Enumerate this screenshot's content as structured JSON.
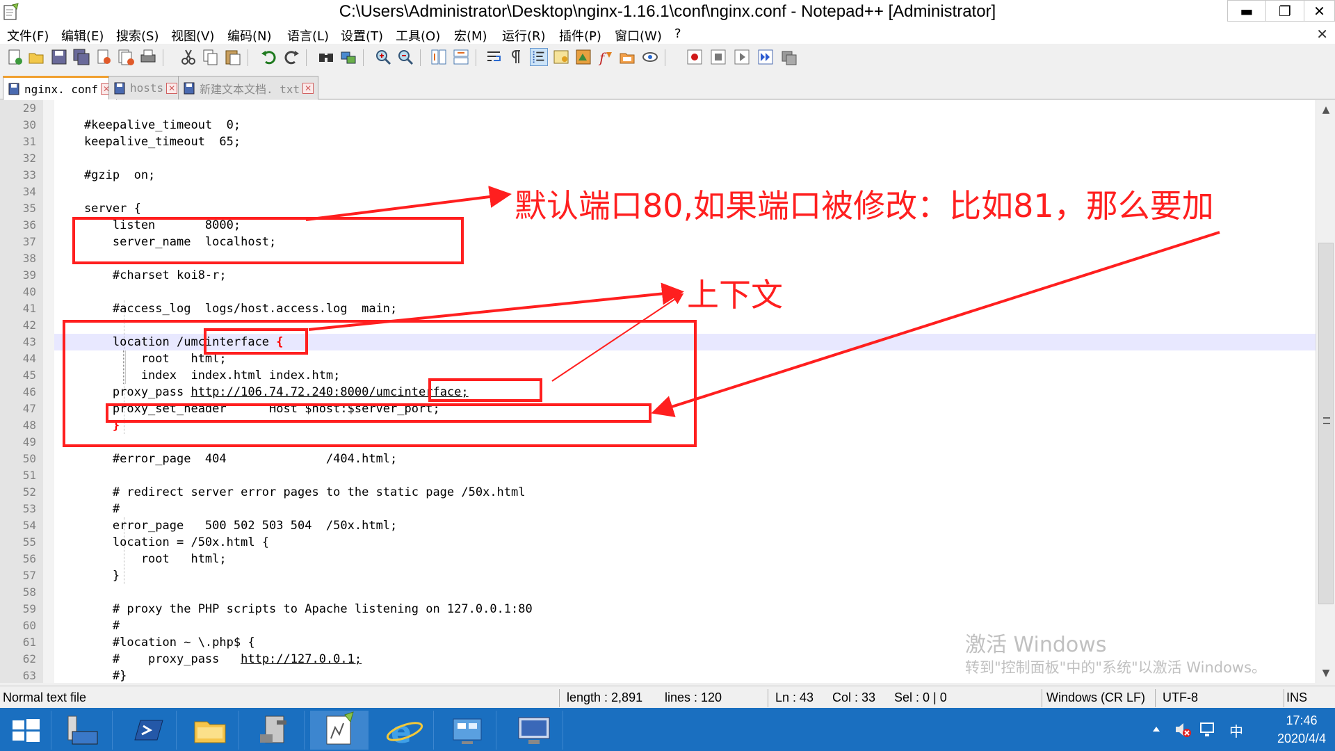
{
  "window": {
    "title": "C:\\Users\\Administrator\\Desktop\\nginx-1.16.1\\conf\\nginx.conf - Notepad++ [Administrator]",
    "min_glyph": "▬",
    "max_glyph": "❐",
    "close_glyph": "✕"
  },
  "menu": {
    "items": [
      "文件(F)",
      "编辑(E)",
      "搜索(S)",
      "视图(V)",
      "编码(N)",
      "语言(L)",
      "设置(T)",
      "工具(O)",
      "宏(M)",
      "运行(R)",
      "插件(P)",
      "窗口(W)",
      "?"
    ],
    "close_glyph": "✕"
  },
  "toolbar": {
    "icons": [
      "new-file-icon",
      "open-file-icon",
      "save-icon",
      "save-all-icon",
      "close-icon",
      "close-all-icon",
      "print-icon",
      "cut-icon",
      "copy-icon",
      "paste-icon",
      "undo-icon",
      "redo-icon",
      "find-icon",
      "replace-icon",
      "zoom-in-icon",
      "zoom-out-icon",
      "sync-vertical-icon",
      "sync-horizontal-icon",
      "word-wrap-icon",
      "show-all-chars-icon",
      "indent-guide-icon",
      "udl-icon",
      "doc-map-icon",
      "function-list-icon",
      "folder-workspace-icon",
      "monitoring-icon",
      "record-macro-icon",
      "stop-macro-icon",
      "play-macro-icon",
      "run-macro-multiple-icon",
      "save-macro-icon"
    ]
  },
  "tabs": [
    {
      "label": "nginx. conf",
      "close": "✕",
      "active": true
    },
    {
      "label": "hosts",
      "close": "✕",
      "active": false
    },
    {
      "label": "新建文本文档. txt",
      "close": "✕",
      "active": false
    }
  ],
  "editor": {
    "lines": [
      {
        "n": "29",
        "text": ""
      },
      {
        "n": "30",
        "text": "    #keepalive_timeout  0;"
      },
      {
        "n": "31",
        "text": "    keepalive_timeout  65;"
      },
      {
        "n": "32",
        "text": ""
      },
      {
        "n": "33",
        "text": "    #gzip  on;"
      },
      {
        "n": "34",
        "text": ""
      },
      {
        "n": "35",
        "text": "    server {"
      },
      {
        "n": "36",
        "text": "        listen       8000;"
      },
      {
        "n": "37",
        "text": "        server_name  localhost;"
      },
      {
        "n": "38",
        "text": ""
      },
      {
        "n": "39",
        "text": "        #charset koi8-r;"
      },
      {
        "n": "40",
        "text": ""
      },
      {
        "n": "41",
        "text": "        #access_log  logs/host.access.log  main;"
      },
      {
        "n": "42",
        "text": ""
      },
      {
        "n": "43",
        "text": "        location /umcinterface ",
        "tail": "{"
      },
      {
        "n": "44",
        "text": "            root   html;"
      },
      {
        "n": "45",
        "text": "            index  index.html index.htm;"
      },
      {
        "n": "46",
        "text": "        proxy_pass ",
        "url": "http://106.74.72.240:8000/umcinterface;"
      },
      {
        "n": "47",
        "text": "        proxy_set_header      Host $host:$server_port;"
      },
      {
        "n": "48",
        "text": "        ",
        "tail": "}"
      },
      {
        "n": "49",
        "text": ""
      },
      {
        "n": "50",
        "text": "        #error_page  404              /404.html;"
      },
      {
        "n": "51",
        "text": ""
      },
      {
        "n": "52",
        "text": "        # redirect server error pages to the static page /50x.html"
      },
      {
        "n": "53",
        "text": "        #"
      },
      {
        "n": "54",
        "text": "        error_page   500 502 503 504  /50x.html;"
      },
      {
        "n": "55",
        "text": "        location = /50x.html {"
      },
      {
        "n": "56",
        "text": "            root   html;"
      },
      {
        "n": "57",
        "text": "        }"
      },
      {
        "n": "58",
        "text": ""
      },
      {
        "n": "59",
        "text": "        # proxy the PHP scripts to Apache listening on 127.0.0.1:80"
      },
      {
        "n": "60",
        "text": "        #"
      },
      {
        "n": "61",
        "text": "        #location ~ \\.php$ {"
      },
      {
        "n": "62",
        "text": "        #    proxy_pass   ",
        "url": "http://127.0.0.1;"
      },
      {
        "n": "63",
        "text": "        #}"
      }
    ]
  },
  "scrollbar": {
    "up": "▲",
    "down": "▼"
  },
  "annotations": {
    "note_port": "默认端口80,如果端口被修改：比如81，那么要加",
    "note_context": "上下文"
  },
  "watermark": {
    "line1": "激活 Windows",
    "line2": "转到\"控制面板\"中的\"系统\"以激活 Windows。"
  },
  "status": {
    "file_type": "Normal text file",
    "length": "length : 2,891",
    "lines": "lines : 120",
    "ln": "Ln : 43",
    "col": "Col : 33",
    "sel": "Sel : 0 | 0",
    "eol": "Windows (CR LF)",
    "encoding": "UTF-8",
    "mode": "INS"
  },
  "taskbar": {
    "apps": [
      "start-icon",
      "server-manager-icon",
      "powershell-icon",
      "file-explorer-icon",
      "server-tools-icon",
      "notepadpp-icon",
      "internet-explorer-icon",
      "control-panel-icon",
      "remote-desktop-icon"
    ],
    "tray_ime": "中",
    "time": "17:46",
    "date": "2020/4/4"
  },
  "colors": {
    "annotation": "#ff1f1f",
    "taskbar": "#1a6fc0",
    "tab_accent": "#f0a030",
    "current_line": "#e8e8ff"
  }
}
